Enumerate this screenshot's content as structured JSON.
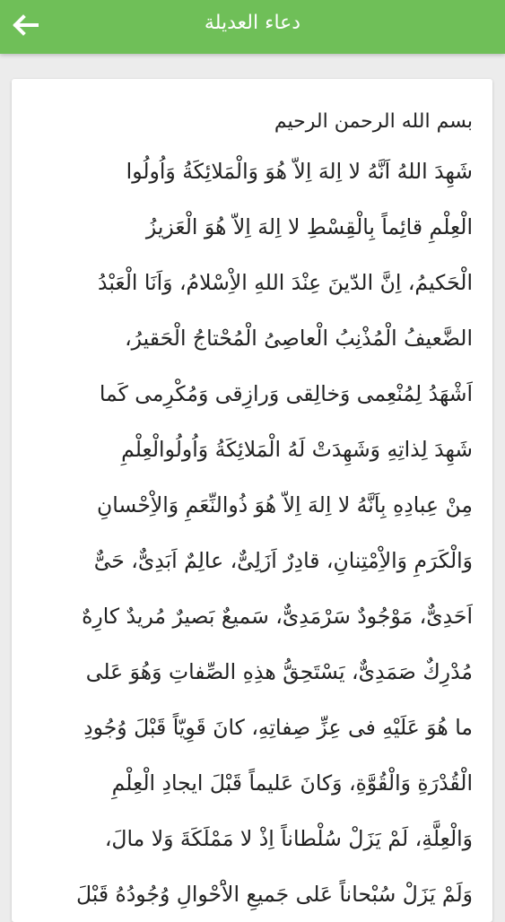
{
  "header": {
    "title": "دعاء العديلة",
    "back_icon": "back-arrow-icon"
  },
  "content": {
    "basmala": "بسم الله الرحمن الرحيم",
    "lines": [
      "شَهِدَ اللهُ اَنَّهُ لا اِلهَ اِلاّ هُوَ وَالْمَلائِكَةُ وَاُولُوا",
      "الْعِلْمِ قائِماً بِالْقِسْطِ لا اِلهَ اِلاّ هُوَ الْعَزيزُ",
      "الْحَكيمُ، اِنَّ الدّينَ عِنْدَ اللهِ الاِْسْلامُ، وَاَنَا الْعَبْدُ",
      "الضَّعيفُ الْمُذْنِبُ الْعاصِىُ الْمُحْتاجُ الْحَقيرُ،",
      "اَشْهَدُ لِمُنْعِمى وَخالِقى وَرازِقى وَمُكْرِمى كَما",
      "شَهِدَ لِذاتِهِ وَشَهِدَتْ لَهُ الْمَلائِكَةُ وَاُولُوالْعِلْمِ",
      "مِنْ عِبادِهِ بِاَنَّهُ لا اِلهَ اِلاّ هُوَ ذُوالنِّعَمِ وَالاِْحْسانِ",
      "وَالْكَرَمِ وَالاِْمْتِنانِ، قادِرٌ اَزَلِىٌّ، عالِمٌ اَبَدِىٌّ، حَىٌّ",
      "اَحَدِىٌّ، مَوْجُودٌ سَرْمَدِىٌّ، سَميعٌ بَصيرٌ مُريدٌ كارِهٌ",
      "مُدْرِكٌ صَمَدِىٌّ، يَسْتَحِقُّ هذِهِ الصِّفاتِ وَهُوَ عَلى",
      "ما هُوَ عَلَيْهِ فى عِزِّ صِفاتِهِ، كانَ قَوِيّاً قَبْلَ وُجُودِ",
      "الْقُدْرَةِ وَالْقُوَّةِ، وَكانَ عَليماً قَبْلَ ايجادِ الْعِلْمِ",
      "وَالْعِلَّةِ، لَمْ يَزَلْ سُلْطاناً اِذْ لا مَمْلَكَةَ وَلا مالَ،",
      "وَلَمْ يَزَلْ سُبْحاناً عَلى جَميعِ الاَْحْوالِ وُجُودُهُ قَبْلَ"
    ]
  }
}
